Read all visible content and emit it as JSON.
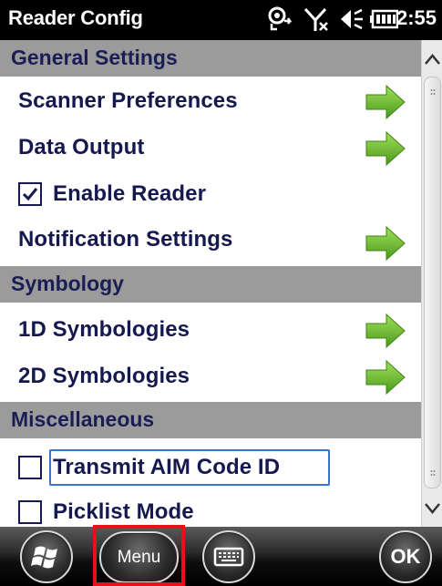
{
  "status_bar": {
    "title": "Reader Config",
    "time": "2:55",
    "icons": [
      "sync-icon",
      "no-signal-icon",
      "speaker-icon",
      "battery-icon"
    ]
  },
  "sections": [
    {
      "header": "General Settings",
      "rows": [
        {
          "type": "link",
          "label": "Scanner Preferences"
        },
        {
          "type": "link",
          "label": "Data Output"
        },
        {
          "type": "checkbox",
          "label": "Enable Reader",
          "checked": true
        },
        {
          "type": "link",
          "label": "Notification Settings"
        }
      ]
    },
    {
      "header": "Symbology",
      "rows": [
        {
          "type": "link",
          "label": "1D Symbologies"
        },
        {
          "type": "link",
          "label": "2D Symbologies"
        }
      ]
    },
    {
      "header": "Miscellaneous",
      "rows": [
        {
          "type": "checkbox",
          "label": "Transmit AIM Code ID",
          "checked": false,
          "focused": true
        },
        {
          "type": "checkbox",
          "label": "Picklist Mode",
          "checked": false
        }
      ]
    }
  ],
  "softkeys": {
    "menu_label": "Menu",
    "ok_label": "OK"
  },
  "colors": {
    "header_bg": "#9b9b9b",
    "text": "#15194f",
    "arrow": "#6cb52c",
    "highlight": "#e8101a",
    "focus": "#3a74d3"
  }
}
